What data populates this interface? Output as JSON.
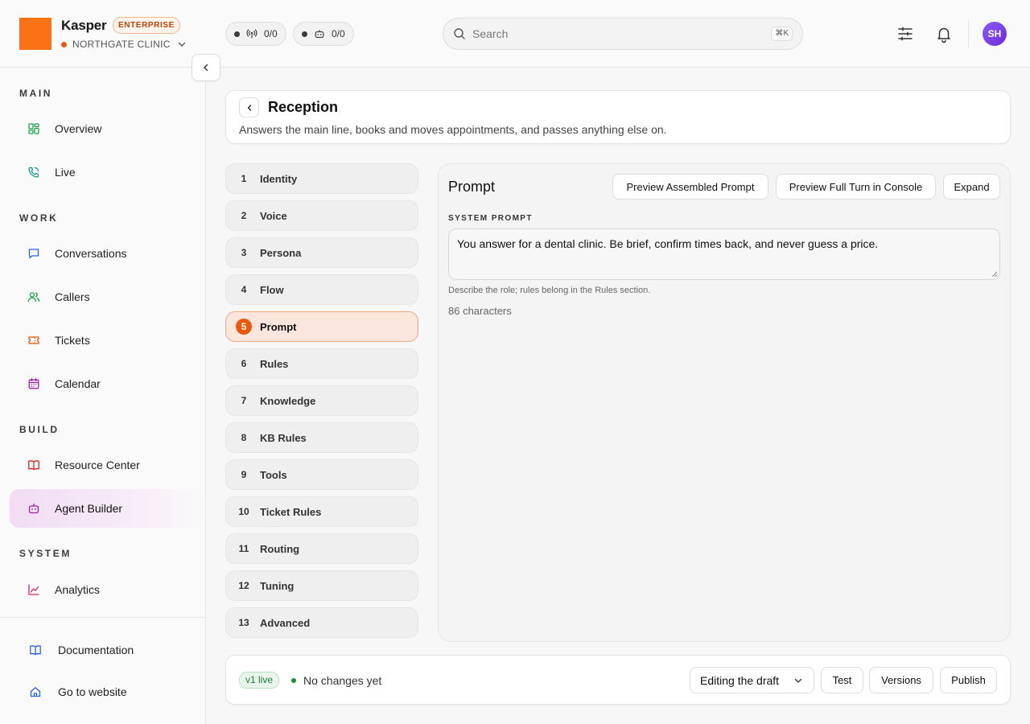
{
  "header": {
    "brand_name": "Kasper",
    "plan_badge": "ENTERPRISE",
    "org_name": "NORTHGATE CLINIC",
    "calls_chip": "0/0",
    "agents_chip": "0/0",
    "search_placeholder": "Search",
    "search_shortcut": "⌘K",
    "avatar_initials": "SH"
  },
  "sidebar": {
    "sections": {
      "main": "MAIN",
      "work": "WORK",
      "build": "BUILD",
      "system": "SYSTEM"
    },
    "items": {
      "overview": "Overview",
      "live": "Live",
      "conversations": "Conversations",
      "callers": "Callers",
      "tickets": "Tickets",
      "calendar": "Calendar",
      "resource_center": "Resource Center",
      "agent_builder": "Agent Builder",
      "analytics": "Analytics"
    },
    "active_item": "Agent Builder",
    "footer": {
      "documentation": "Documentation",
      "website": "Go to website"
    }
  },
  "page": {
    "title": "Reception",
    "description": "Answers the main line, books and moves appointments, and passes anything else on."
  },
  "steps": [
    {
      "num": "1",
      "label": "Identity"
    },
    {
      "num": "2",
      "label": "Voice"
    },
    {
      "num": "3",
      "label": "Persona"
    },
    {
      "num": "4",
      "label": "Flow"
    },
    {
      "num": "5",
      "label": "Prompt"
    },
    {
      "num": "6",
      "label": "Rules"
    },
    {
      "num": "7",
      "label": "Knowledge"
    },
    {
      "num": "8",
      "label": "KB Rules"
    },
    {
      "num": "9",
      "label": "Tools"
    },
    {
      "num": "10",
      "label": "Ticket Rules"
    },
    {
      "num": "11",
      "label": "Routing"
    },
    {
      "num": "12",
      "label": "Tuning"
    },
    {
      "num": "13",
      "label": "Advanced"
    }
  ],
  "active_step": "Prompt",
  "prompt_panel": {
    "title": "Prompt",
    "preview_assembled_label": "Preview Assembled Prompt",
    "preview_turn_label": "Preview Full Turn in Console",
    "expand_label": "Expand",
    "system_prompt_label": "SYSTEM PROMPT",
    "system_prompt_value": "You answer for a dental clinic. Be brief, confirm times back, and never guess a price.",
    "hint": "Describe the role; rules belong in the Rules section.",
    "char_count": "86 characters"
  },
  "bottom_bar": {
    "live_badge": "v1 live",
    "status": "No changes yet",
    "draft_select": "Editing the draft",
    "test_label": "Test",
    "versions_label": "Versions",
    "publish_label": "Publish"
  },
  "colors": {
    "brand": "#f97316",
    "accent": "#ea580c",
    "active_nav": "#f1dcf4",
    "live_green": "#1f8b3a"
  }
}
